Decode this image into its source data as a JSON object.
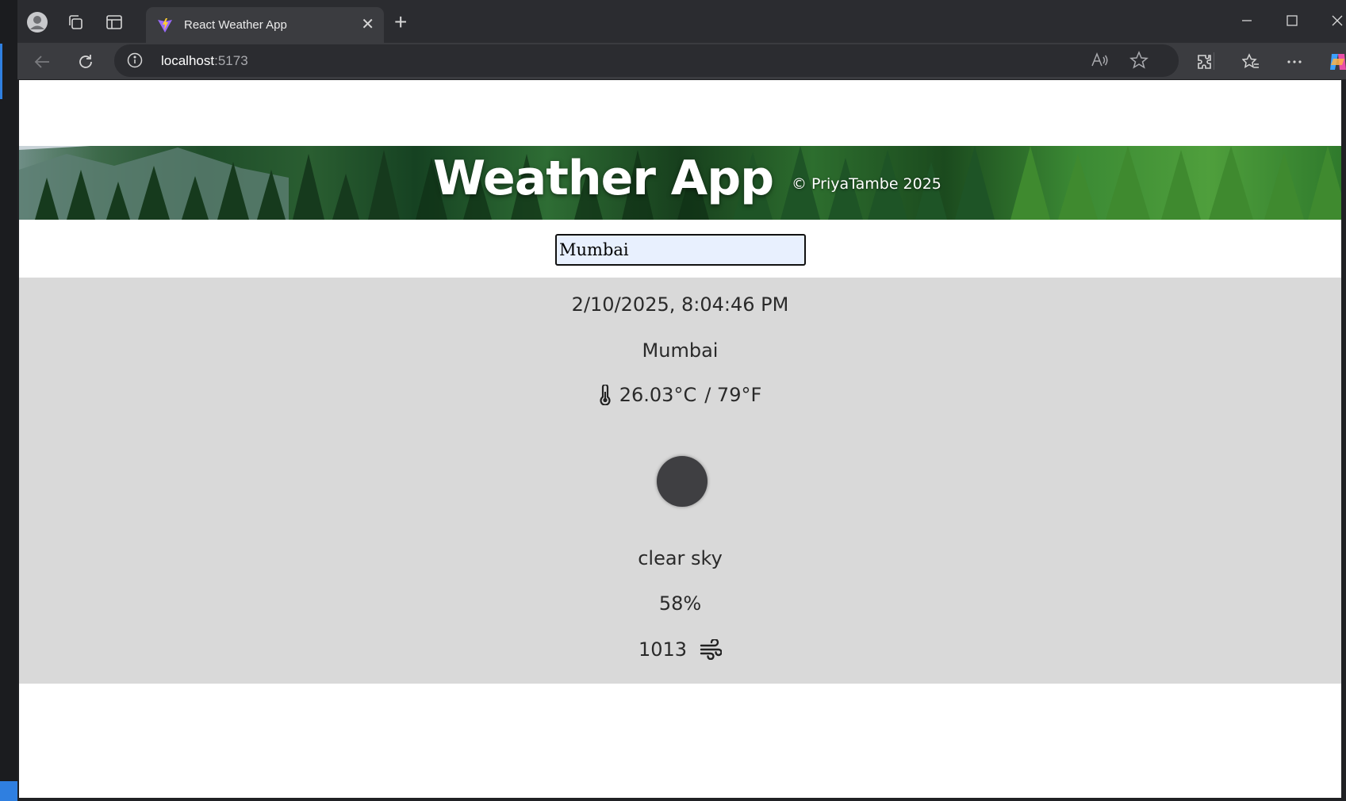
{
  "browser": {
    "tab_title": "React Weather App",
    "url_host": "localhost",
    "url_port": ":5173"
  },
  "app": {
    "title": "Weather App",
    "credit": "© PriyaTambe 2025"
  },
  "search": {
    "value": "Mumbai"
  },
  "weather": {
    "datetime": "2/10/2025, 8:04:46 PM",
    "city": "Mumbai",
    "temp_c": "26.03°C",
    "temp_f": " / 79°F",
    "description": "clear sky",
    "humidity": "58%",
    "pressure": "1013"
  },
  "icons": {
    "thermometer": "thermometer-icon",
    "wind": "wind-icon",
    "weather": "clear-sky-night-icon"
  }
}
